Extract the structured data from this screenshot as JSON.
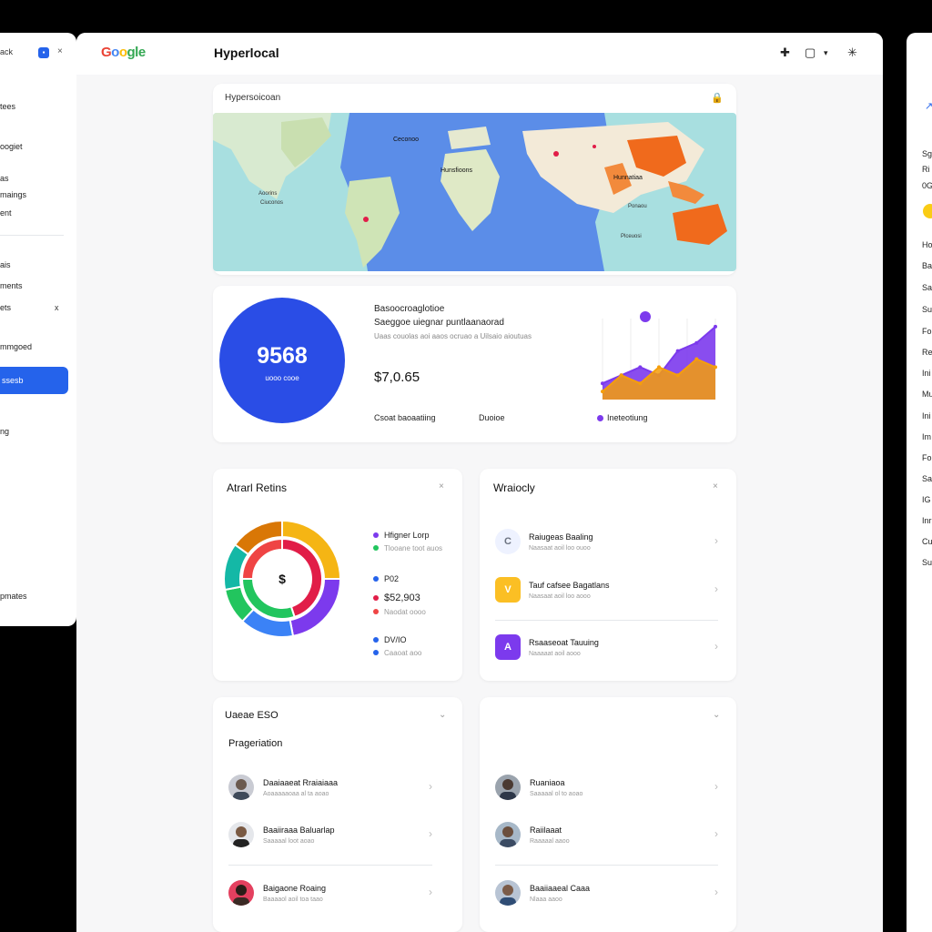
{
  "left_panel": {
    "top_label": "ack",
    "items": [
      "tees",
      "oogiet",
      "as",
      "maings",
      "ent",
      "ais",
      "ments",
      "ets",
      "mmgoed",
      "ng",
      "pmates"
    ],
    "active_item": "ssesb",
    "x2": "x"
  },
  "header": {
    "logo": [
      "G",
      "o",
      "o",
      "gle"
    ],
    "title": "Hyperlocal"
  },
  "map_card": {
    "title": "Hypersoicoan",
    "labels": [
      "Ceconoo",
      "Hunnatiaa",
      "Hunsfioons",
      "Aoorins",
      "Ciuconos",
      "Ponaou",
      "Plceuosi"
    ]
  },
  "stats_card": {
    "circle_value": "9568",
    "circle_caption": "uooo cooe",
    "line1": "Basoocroaglotioe",
    "line2": "Saeggoe uiegnar puntlaanaorad",
    "line3": "Uaas couolas aoi aaos ocruao a Uilsaio aioutuas",
    "price": "$7,0.65",
    "footer1": "Csoat baoaatiing",
    "footer2": "Duoioe",
    "legend": "Ineteotiung",
    "chart_series": [
      {
        "name": "Ineteotiung",
        "color": "#7c3aed",
        "values": [
          2,
          3,
          4,
          3,
          6,
          7,
          9
        ]
      },
      {
        "name": "",
        "color": "#f59e0b",
        "values": [
          1,
          3,
          2,
          4,
          3,
          5,
          4
        ]
      }
    ]
  },
  "donut_card": {
    "title": "Atrarl Retins",
    "center_symbol": "$",
    "legend": [
      {
        "label": "Hfigner Lorp",
        "color": "#7c3aed",
        "style": "normal"
      },
      {
        "label": "Tlooane toot auos",
        "color": "#22c55e",
        "style": "sub"
      },
      {
        "label": "P02",
        "color": "#2563eb",
        "style": "normal"
      },
      {
        "label": "$52,903",
        "color": "#e11d48",
        "style": "big"
      },
      {
        "label": "Naodat oooo",
        "color": "#ef4444",
        "style": "sub"
      },
      {
        "label": "DV/IO",
        "color": "#2563eb",
        "style": "normal"
      },
      {
        "label": "Caaoat aoo",
        "color": "#2563eb",
        "style": "sub"
      }
    ],
    "segments": [
      {
        "color": "#f5b514",
        "value": 25
      },
      {
        "color": "#7c3aed",
        "value": 22
      },
      {
        "color": "#3b82f6",
        "value": 15
      },
      {
        "color": "#22c55e",
        "value": 10
      },
      {
        "color": "#14b8a6",
        "value": 13
      },
      {
        "color": "#d97706",
        "value": 15
      }
    ],
    "inner_segments": [
      {
        "color": "#e11d48",
        "value": 45
      },
      {
        "color": "#22c55e",
        "value": 30
      },
      {
        "color": "#ef4444",
        "value": 25
      }
    ]
  },
  "weekly_card": {
    "title": "Wraiocly",
    "rows": [
      {
        "icon": "C",
        "title": "Raiugeas Baaling",
        "subtitle": "Naasaat aoil loo ouoo",
        "icon_bg": "#eef2ff",
        "icon_color": "#6b7280"
      },
      {
        "icon": "V",
        "title": "Tauf cafsee Bagatlans",
        "subtitle": "Naasaat aoil loo aooo",
        "icon_bg": "#fbbf24",
        "icon_color": "#ffffff"
      },
      {
        "icon": "A",
        "title": "Rsaaseoat Tauuing",
        "subtitle": "Naaaaat aoil aooo",
        "icon_bg": "#7c3aed",
        "icon_color": "#ffffff"
      }
    ]
  },
  "people_card": {
    "title": "Uaeae ESO",
    "subtitle": "Prageriation",
    "rows": [
      {
        "title": "Daaiaaeat Rraiaiaaa",
        "subtitle": "Aoaaaaaoaa al ta aoao"
      },
      {
        "title": "Baaiiraaa Baluarlap",
        "subtitle": "Saaaaal loot aoao"
      },
      {
        "title": "Baigaone Roaing",
        "subtitle": "Baaaaol aoil toa taao"
      }
    ]
  },
  "people2_card": {
    "rows": [
      {
        "title": "Ruaniaoa",
        "subtitle": "Saaaaal ol to aoao"
      },
      {
        "title": "Raiilaaat",
        "subtitle": "Raaaaal aaoo"
      },
      {
        "title": "Baaiiaaeal Caaa",
        "subtitle": "Nlaaa aaoo"
      }
    ]
  },
  "right_panel": {
    "items": [
      "Sg",
      "Ri",
      "0G",
      "Ho",
      "Ba",
      "Sa",
      "Su",
      "Fo",
      "Re",
      "Ini",
      "Mu",
      "Ini",
      "Im",
      "Fo",
      "Sa",
      "IG",
      "Inr",
      "Cu",
      "Su"
    ]
  }
}
